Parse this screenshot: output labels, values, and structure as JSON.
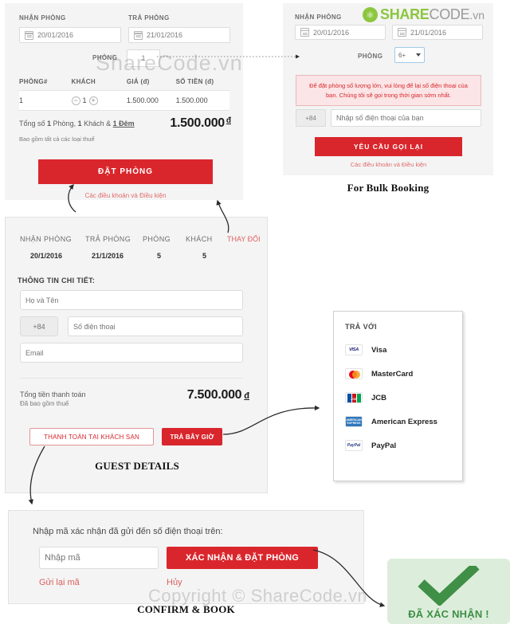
{
  "watermarks": {
    "top": "ShareCode.vn",
    "bottom": "Copyright © ShareCode.vn",
    "logo_share": "SHARE",
    "logo_code": "CODE",
    "logo_tld": ".vn"
  },
  "booking_panel": {
    "checkin_label": "NHẬN PHÒNG",
    "checkout_label": "TRẢ PHÒNG",
    "checkin_value": "20/01/2016",
    "checkout_value": "21/01/2016",
    "rooms_label": "PHÒNG",
    "rooms_value": "1",
    "table_headers": [
      "PHÒNG#",
      "KHÁCH",
      "GIÁ (đ)",
      "SỐ TIỀN (đ)"
    ],
    "rows": [
      {
        "room": "1",
        "guests": "1",
        "minus": "−",
        "plus": "+",
        "price": "1.500.000",
        "amount": "1.500.000"
      }
    ],
    "summary_prefix": "Tổng số ",
    "summary_rooms": "1",
    "summary_mid1": " Phòng, ",
    "summary_guests": "1",
    "summary_mid2": " Khách & ",
    "summary_nights": "1 Đêm",
    "total_value": "1.500.000",
    "currency": "đ",
    "tax_note": "Bao gồm tất cả các loại thuế",
    "book_button": "ĐẶT PHÒNG",
    "terms": "Các điều khoản và Điều kiện"
  },
  "bulk_panel": {
    "checkin_label": "NHẬN PHÒNG",
    "checkin_value": "20/01/2016",
    "checkout_value": "21/01/2016",
    "rooms_label": "PHÒNG",
    "rooms_value": "6+",
    "notice": "Để đặt phòng số lượng lớn, vui lòng để lại số điện thoại của bạn. Chúng tôi sẽ gọi trong thời gian sớm nhất.",
    "country_code": "+84",
    "phone_placeholder": "Nhập số điện thoại của bạn",
    "callback_button": "YÊU CẦU GỌI LẠI",
    "terms": "Các điều khoản và Điều kiện",
    "caption": "For Bulk Booking"
  },
  "guest_panel": {
    "summary_headers": [
      "NHẬN PHÒNG",
      "TRẢ PHÒNG",
      "PHÒNG",
      "KHÁCH"
    ],
    "change_link": "THAY ĐỔI",
    "summary_values": [
      "20/1/2016",
      "21/1/2016",
      "5",
      "5"
    ],
    "details_title": "THÔNG TIN CHI TIẾT:",
    "name_placeholder": "Họ và Tên",
    "country_code": "+84",
    "phone_placeholder": "Số điện thoại",
    "email_placeholder": "Email",
    "total_label": "Tổng tiền thanh toán",
    "tax_note": "Đã bao gồm thuế",
    "total_value": "7.500.000",
    "currency": "đ",
    "pay_hotel_button": "THANH TOÁN TẠI KHÁCH SẠN",
    "pay_now_button": "TRẢ BÂY GIỜ",
    "caption": "GUEST DETAILS"
  },
  "payment_panel": {
    "title": "TRẢ VỚI",
    "methods": [
      {
        "icon": "visa-icon",
        "label": "Visa"
      },
      {
        "icon": "mastercard-icon",
        "label": "MasterCard"
      },
      {
        "icon": "jcb-icon",
        "label": "JCB"
      },
      {
        "icon": "amex-icon",
        "label": "American Express"
      },
      {
        "icon": "paypal-icon",
        "label": "PayPal"
      }
    ]
  },
  "confirm_panel": {
    "prompt": "Nhập mã xác nhận đã gửi đến số điện thoại trên:",
    "code_placeholder": "Nhập mã",
    "confirm_button": "XÁC NHẬN & ĐẶT PHÒNG",
    "resend_link": "Gửi lại mã",
    "cancel_link": "Hủy",
    "caption": "CONFIRM & BOOK"
  },
  "success_box": {
    "check_icon": "check-icon",
    "label": "ĐÃ XÁC NHẬN !"
  },
  "colors": {
    "red": "#d9262c",
    "panel": "#f4f4f4",
    "link_red": "#e06a6a",
    "green": "#3f8f46",
    "green_bg": "#dceedb"
  }
}
